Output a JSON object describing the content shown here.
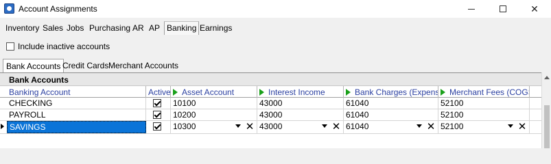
{
  "window": {
    "title": "Account Assignments",
    "icon": "app-icon"
  },
  "menu": {
    "items": [
      "Inventory",
      "Sales",
      "Jobs",
      "Purchasing",
      "AR",
      "AP",
      "Banking",
      "Earnings"
    ],
    "active": "Banking"
  },
  "options": {
    "include_inactive_label": "Include inactive accounts",
    "include_inactive_checked": false
  },
  "subtabs": {
    "items": [
      "Bank Accounts",
      "Credit Cards",
      "Merchant Accounts"
    ],
    "active": "Bank Accounts"
  },
  "grid": {
    "title": "Bank Accounts",
    "columns": [
      "Banking Account",
      "Active",
      "Asset Account",
      "Interest Income",
      "Bank Charges (Expense)",
      "Merchant Fees (COGS)"
    ],
    "rows": [
      {
        "name": "CHECKING",
        "active": true,
        "asset": "10100",
        "interest": "43000",
        "charges": "61040",
        "fees": "52100"
      },
      {
        "name": "PAYROLL",
        "active": true,
        "asset": "10200",
        "interest": "43000",
        "charges": "61040",
        "fees": "52100"
      },
      {
        "name": "SAVINGS",
        "active": true,
        "asset": "10300",
        "interest": "43000",
        "charges": "61040",
        "fees": "52100"
      }
    ],
    "selected_row": 2
  },
  "colors": {
    "selection": "#0a74d8",
    "header_text": "#2a3fa0",
    "sort_marker": "#1aa01a"
  }
}
